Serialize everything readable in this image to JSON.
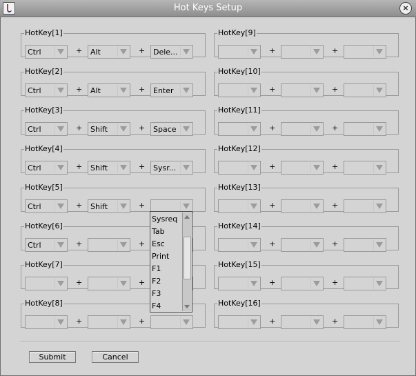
{
  "window": {
    "title": "Hot Keys Setup"
  },
  "hotkeys": [
    {
      "label": "HotKey[1]",
      "keys": [
        "Ctrl",
        "Alt",
        "Dele..."
      ]
    },
    {
      "label": "HotKey[2]",
      "keys": [
        "Ctrl",
        "Alt",
        "Enter"
      ]
    },
    {
      "label": "HotKey[3]",
      "keys": [
        "Ctrl",
        "Shift",
        "Space"
      ]
    },
    {
      "label": "HotKey[4]",
      "keys": [
        "Ctrl",
        "Shift",
        "Sysr..."
      ]
    },
    {
      "label": "HotKey[5]",
      "keys": [
        "Ctrl",
        "Shift",
        ""
      ]
    },
    {
      "label": "HotKey[6]",
      "keys": [
        "Ctrl",
        "",
        ""
      ]
    },
    {
      "label": "HotKey[7]",
      "keys": [
        "",
        "",
        ""
      ]
    },
    {
      "label": "HotKey[8]",
      "keys": [
        "",
        "",
        ""
      ]
    },
    {
      "label": "HotKey[9]",
      "keys": [
        "",
        "",
        ""
      ]
    },
    {
      "label": "HotKey[10]",
      "keys": [
        "",
        "",
        ""
      ]
    },
    {
      "label": "HotKey[11]",
      "keys": [
        "",
        "",
        ""
      ]
    },
    {
      "label": "HotKey[12]",
      "keys": [
        "",
        "",
        ""
      ]
    },
    {
      "label": "HotKey[13]",
      "keys": [
        "",
        "",
        ""
      ]
    },
    {
      "label": "HotKey[14]",
      "keys": [
        "",
        "",
        ""
      ]
    },
    {
      "label": "HotKey[15]",
      "keys": [
        "",
        "",
        ""
      ]
    },
    {
      "label": "HotKey[16]",
      "keys": [
        "",
        "",
        ""
      ]
    }
  ],
  "separator": "+",
  "dropdown": {
    "options": [
      "Sysreq",
      "Tab",
      "Esc",
      "Print",
      "F1",
      "F2",
      "F3",
      "F4"
    ]
  },
  "buttons": {
    "submit": "Submit",
    "cancel": "Cancel"
  },
  "colors": {
    "background": "#d4d4d4",
    "titlebar": "#9e9e9e",
    "border": "#9a9a9a"
  },
  "icons": {
    "app": "java-app-icon",
    "close": "close-icon"
  }
}
